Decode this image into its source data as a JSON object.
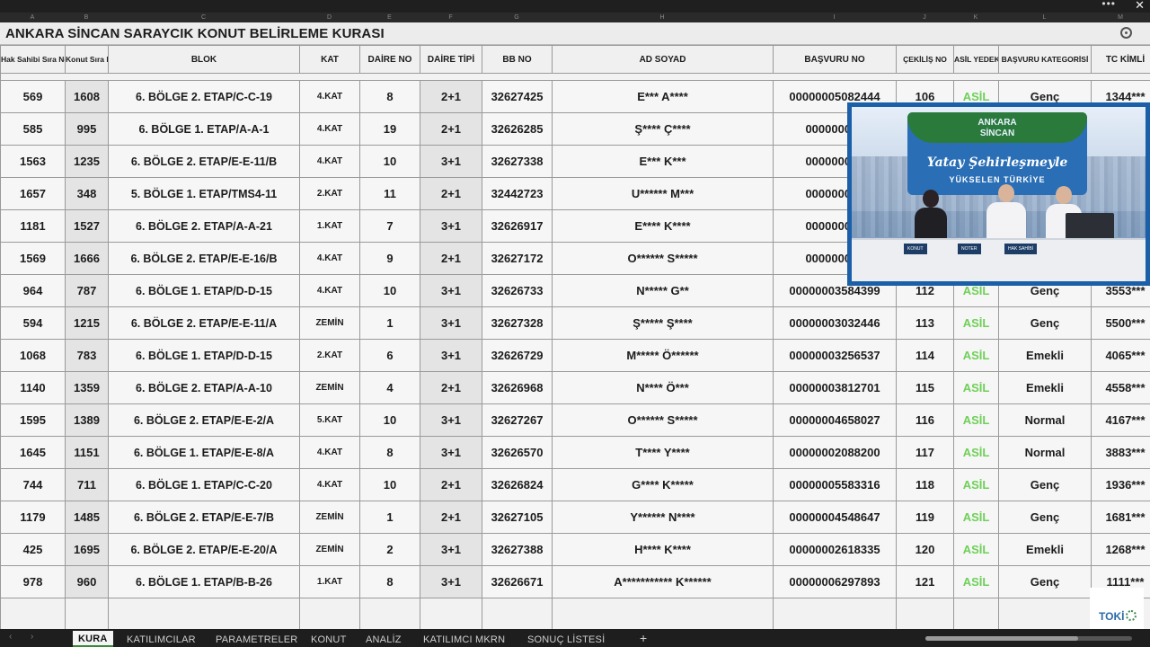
{
  "window": {
    "more_label": "•••",
    "close_label": "✕"
  },
  "column_letters": [
    "A",
    "B",
    "C",
    "D",
    "E",
    "F",
    "G",
    "H",
    "I",
    "J",
    "K",
    "L",
    "M"
  ],
  "sheet_title": "ANKARA SİNCAN SARAYCIK KONUT BELİRLEME KURASI",
  "headers": [
    "Hak Sahibi Sıra No",
    "Konut Sıra No",
    "BLOK",
    "KAT",
    "DAİRE NO",
    "DAİRE TİPİ",
    "BB NO",
    "AD SOYAD",
    "BAŞVURU NO",
    "ÇEKİLİŞ NO",
    "ASİL YEDEK",
    "BAŞVURU KATEGORİSİ",
    "TC KİMLİ"
  ],
  "rows": [
    {
      "hak": "569",
      "konut": "1608",
      "blok": "6. BÖLGE 2. ETAP/C-C-19",
      "kat": "4.KAT",
      "daire": "8",
      "tip": "2+1",
      "bb": "32627425",
      "ad": "E*** A****",
      "basvuru": "00000005082444",
      "cekilis": "106",
      "asil": "ASİL",
      "kategori": "Genç",
      "tc": "1344***"
    },
    {
      "hak": "585",
      "konut": "995",
      "blok": "6. BÖLGE 1. ETAP/A-A-1",
      "kat": "4.KAT",
      "daire": "19",
      "tip": "2+1",
      "bb": "32626285",
      "ad": "Ş**** Ç****",
      "basvuru": "000000033",
      "cekilis": "",
      "asil": "",
      "kategori": "",
      "tc": ""
    },
    {
      "hak": "1563",
      "konut": "1235",
      "blok": "6. BÖLGE 2. ETAP/E-E-11/B",
      "kat": "4.KAT",
      "daire": "10",
      "tip": "3+1",
      "bb": "32627338",
      "ad": "E*** K***",
      "basvuru": "000000021",
      "cekilis": "",
      "asil": "",
      "kategori": "",
      "tc": ""
    },
    {
      "hak": "1657",
      "konut": "348",
      "blok": "5. BÖLGE 1. ETAP/TMS4-11",
      "kat": "2.KAT",
      "daire": "11",
      "tip": "2+1",
      "bb": "32442723",
      "ad": "U****** M***",
      "basvuru": "000000028",
      "cekilis": "",
      "asil": "",
      "kategori": "",
      "tc": ""
    },
    {
      "hak": "1181",
      "konut": "1527",
      "blok": "6. BÖLGE 2. ETAP/A-A-21",
      "kat": "1.KAT",
      "daire": "7",
      "tip": "3+1",
      "bb": "32626917",
      "ad": "E**** K****",
      "basvuru": "000000034",
      "cekilis": "",
      "asil": "",
      "kategori": "",
      "tc": ""
    },
    {
      "hak": "1569",
      "konut": "1666",
      "blok": "6. BÖLGE 2. ETAP/E-E-16/B",
      "kat": "4.KAT",
      "daire": "9",
      "tip": "2+1",
      "bb": "32627172",
      "ad": "O****** S*****",
      "basvuru": "000000065",
      "cekilis": "",
      "asil": "",
      "kategori": "",
      "tc": ""
    },
    {
      "hak": "964",
      "konut": "787",
      "blok": "6. BÖLGE 1. ETAP/D-D-15",
      "kat": "4.KAT",
      "daire": "10",
      "tip": "3+1",
      "bb": "32626733",
      "ad": "N***** G**",
      "basvuru": "00000003584399",
      "cekilis": "112",
      "asil": "ASİL",
      "kategori": "Genç",
      "tc": "3553***"
    },
    {
      "hak": "594",
      "konut": "1215",
      "blok": "6. BÖLGE 2. ETAP/E-E-11/A",
      "kat": "ZEMİN",
      "daire": "1",
      "tip": "3+1",
      "bb": "32627328",
      "ad": "Ş***** Ş****",
      "basvuru": "00000003032446",
      "cekilis": "113",
      "asil": "ASİL",
      "kategori": "Genç",
      "tc": "5500***"
    },
    {
      "hak": "1068",
      "konut": "783",
      "blok": "6. BÖLGE 1. ETAP/D-D-15",
      "kat": "2.KAT",
      "daire": "6",
      "tip": "3+1",
      "bb": "32626729",
      "ad": "M***** Ö******",
      "basvuru": "00000003256537",
      "cekilis": "114",
      "asil": "ASİL",
      "kategori": "Emekli",
      "tc": "4065***"
    },
    {
      "hak": "1140",
      "konut": "1359",
      "blok": "6. BÖLGE 2. ETAP/A-A-10",
      "kat": "ZEMİN",
      "daire": "4",
      "tip": "2+1",
      "bb": "32626968",
      "ad": "N**** Ö***",
      "basvuru": "00000003812701",
      "cekilis": "115",
      "asil": "ASİL",
      "kategori": "Emekli",
      "tc": "4558***"
    },
    {
      "hak": "1595",
      "konut": "1389",
      "blok": "6. BÖLGE 2. ETAP/E-E-2/A",
      "kat": "5.KAT",
      "daire": "10",
      "tip": "3+1",
      "bb": "32627267",
      "ad": "O****** S*****",
      "basvuru": "00000004658027",
      "cekilis": "116",
      "asil": "ASİL",
      "kategori": "Normal",
      "tc": "4167***"
    },
    {
      "hak": "1645",
      "konut": "1151",
      "blok": "6. BÖLGE 1. ETAP/E-E-8/A",
      "kat": "4.KAT",
      "daire": "8",
      "tip": "3+1",
      "bb": "32626570",
      "ad": "T**** Y****",
      "basvuru": "00000002088200",
      "cekilis": "117",
      "asil": "ASİL",
      "kategori": "Normal",
      "tc": "3883***"
    },
    {
      "hak": "744",
      "konut": "711",
      "blok": "6. BÖLGE 1. ETAP/C-C-20",
      "kat": "4.KAT",
      "daire": "10",
      "tip": "2+1",
      "bb": "32626824",
      "ad": "G**** K*****",
      "basvuru": "00000005583316",
      "cekilis": "118",
      "asil": "ASİL",
      "kategori": "Genç",
      "tc": "1936***"
    },
    {
      "hak": "1179",
      "konut": "1485",
      "blok": "6. BÖLGE 2. ETAP/E-E-7/B",
      "kat": "ZEMİN",
      "daire": "1",
      "tip": "2+1",
      "bb": "32627105",
      "ad": "Y****** N****",
      "basvuru": "00000004548647",
      "cekilis": "119",
      "asil": "ASİL",
      "kategori": "Genç",
      "tc": "1681***"
    },
    {
      "hak": "425",
      "konut": "1695",
      "blok": "6. BÖLGE 2. ETAP/E-E-20/A",
      "kat": "ZEMİN",
      "daire": "2",
      "tip": "3+1",
      "bb": "32627388",
      "ad": "H**** K****",
      "basvuru": "00000002618335",
      "cekilis": "120",
      "asil": "ASİL",
      "kategori": "Emekli",
      "tc": "1268***"
    },
    {
      "hak": "978",
      "konut": "960",
      "blok": "6. BÖLGE 1. ETAP/B-B-26",
      "kat": "1.KAT",
      "daire": "8",
      "tip": "3+1",
      "bb": "32626671",
      "ad": "A*********** K******",
      "basvuru": "00000006297893",
      "cekilis": "121",
      "asil": "ASİL",
      "kategori": "Genç",
      "tc": "1111***"
    }
  ],
  "video": {
    "banner_line1": "ANKARA",
    "banner_line2": "SİNCAN",
    "slogan": "Yatay Şehirleşmeyle",
    "slogan2": "YÜKSELEN TÜRKİYE",
    "tag1": "KONUT",
    "tag2": "NOTER",
    "tag3": "HAK SAHİBİ"
  },
  "logo_text": "TOKİ",
  "tabs": [
    "KURA",
    "KATILIMCILAR",
    "PARAMETRELER",
    "KONUT",
    "ANALİZ",
    "KATILIMCI MKRN",
    "SONUÇ LİSTESİ"
  ],
  "active_tab": "KURA",
  "add_tab_label": "+"
}
